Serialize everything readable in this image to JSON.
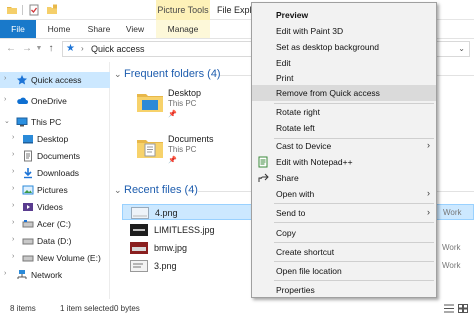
{
  "window": {
    "title": "File Explo",
    "contextual_tab_group": "Picture Tools"
  },
  "ribbon": {
    "tabs": [
      {
        "label": "File",
        "active": true
      },
      {
        "label": "Home"
      },
      {
        "label": "Share"
      },
      {
        "label": "View"
      },
      {
        "label": "Manage"
      }
    ]
  },
  "address": {
    "location_icon": "star-icon",
    "path": "Quick access"
  },
  "sidebar": {
    "items": [
      {
        "label": "Quick access",
        "icon": "star-icon",
        "selected": true
      },
      {
        "label": "OneDrive",
        "icon": "cloud-icon"
      },
      {
        "label": "This PC",
        "icon": "computer-icon"
      },
      {
        "label": "Desktop",
        "icon": "desktop-folder-icon"
      },
      {
        "label": "Documents",
        "icon": "documents-icon"
      },
      {
        "label": "Downloads",
        "icon": "downloads-icon"
      },
      {
        "label": "Pictures",
        "icon": "pictures-icon"
      },
      {
        "label": "Videos",
        "icon": "videos-icon"
      },
      {
        "label": "Acer (C:)",
        "icon": "drive-icon"
      },
      {
        "label": "Data (D:)",
        "icon": "drive-icon"
      },
      {
        "label": "New Volume (E:)",
        "icon": "drive-icon"
      },
      {
        "label": "Network",
        "icon": "network-icon"
      }
    ]
  },
  "main": {
    "frequent_header": "Frequent folders (4)",
    "frequent": [
      {
        "name": "Desktop",
        "location": "This PC"
      },
      {
        "name": "Documents",
        "location": "This PC"
      }
    ],
    "recent_header": "Recent files (4)",
    "recent": [
      {
        "name": "4.png",
        "location": "Work",
        "selected": true
      },
      {
        "name": "LIMITLESS.jpg"
      },
      {
        "name": "bmw.jpg",
        "location": "Work"
      },
      {
        "name": "3.png",
        "location": "Work"
      }
    ]
  },
  "status": {
    "items": "8 items",
    "selection": "1 item selected",
    "size": "0 bytes"
  },
  "context_menu": {
    "items": [
      {
        "label": "Preview",
        "bold": true
      },
      {
        "label": "Edit with Paint 3D"
      },
      {
        "label": "Set as desktop background"
      },
      {
        "label": "Edit"
      },
      {
        "label": "Print"
      },
      {
        "label": "Remove from Quick access",
        "highlighted": true
      },
      {
        "label": "Rotate right"
      },
      {
        "label": "Rotate left"
      },
      {
        "label": "Cast to Device",
        "submenu": true
      },
      {
        "label": "Edit with Notepad++",
        "icon": "notepad-icon"
      },
      {
        "label": "Share",
        "icon": "share-icon"
      },
      {
        "label": "Open with",
        "submenu": true
      },
      {
        "label": "Send to",
        "submenu": true
      },
      {
        "label": "Copy"
      },
      {
        "label": "Create shortcut"
      },
      {
        "label": "Open file location"
      },
      {
        "label": "Properties"
      }
    ]
  },
  "colors": {
    "accent": "#1979ca",
    "selection": "#cce8ff",
    "picture_tools": "#fdf1b8",
    "group_heading": "#1e5dae"
  }
}
